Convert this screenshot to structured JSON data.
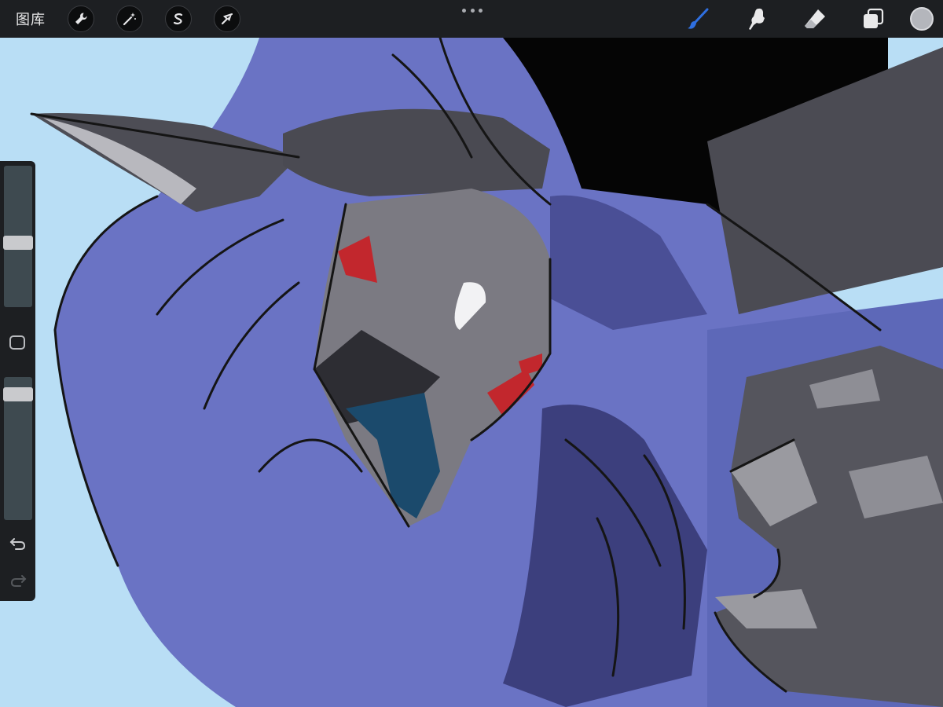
{
  "toolbar": {
    "gallery_label": "图库",
    "left_tools": [
      {
        "name": "actions",
        "icon": "wrench-icon"
      },
      {
        "name": "adjustments",
        "icon": "magic-wand-icon"
      },
      {
        "name": "selection",
        "icon": "selection-s-icon"
      },
      {
        "name": "transform",
        "icon": "arrow-cursor-icon"
      }
    ],
    "more_icon": "ellipsis-icon",
    "right_tools": [
      {
        "name": "brush",
        "icon": "brush-icon",
        "active": true
      },
      {
        "name": "smudge",
        "icon": "smudge-finger-icon",
        "active": false
      },
      {
        "name": "eraser",
        "icon": "eraser-icon",
        "active": false
      },
      {
        "name": "layers",
        "icon": "layers-icon",
        "active": false
      }
    ],
    "current_color": "#b4b6bc",
    "active_color": "#2f6fe0"
  },
  "sidebar": {
    "brush_size_level": 0.55,
    "opacity_level": 0.08,
    "modify_icon": "square-icon",
    "undo_icon": "undo-arrow-icon",
    "redo_icon": "redo-arrow-icon",
    "redo_enabled": false
  },
  "colors": {
    "toolbar_bg": "#1d1f22",
    "canvas_sky": "#b9def5",
    "cloak_blue": "#6a73c4",
    "cloak_dark": "#3c3f7d",
    "mask_gray": "#7b7a82",
    "hair_black": "#050505",
    "hand_gray": "#55555d",
    "accent_red": "#c2272d"
  }
}
